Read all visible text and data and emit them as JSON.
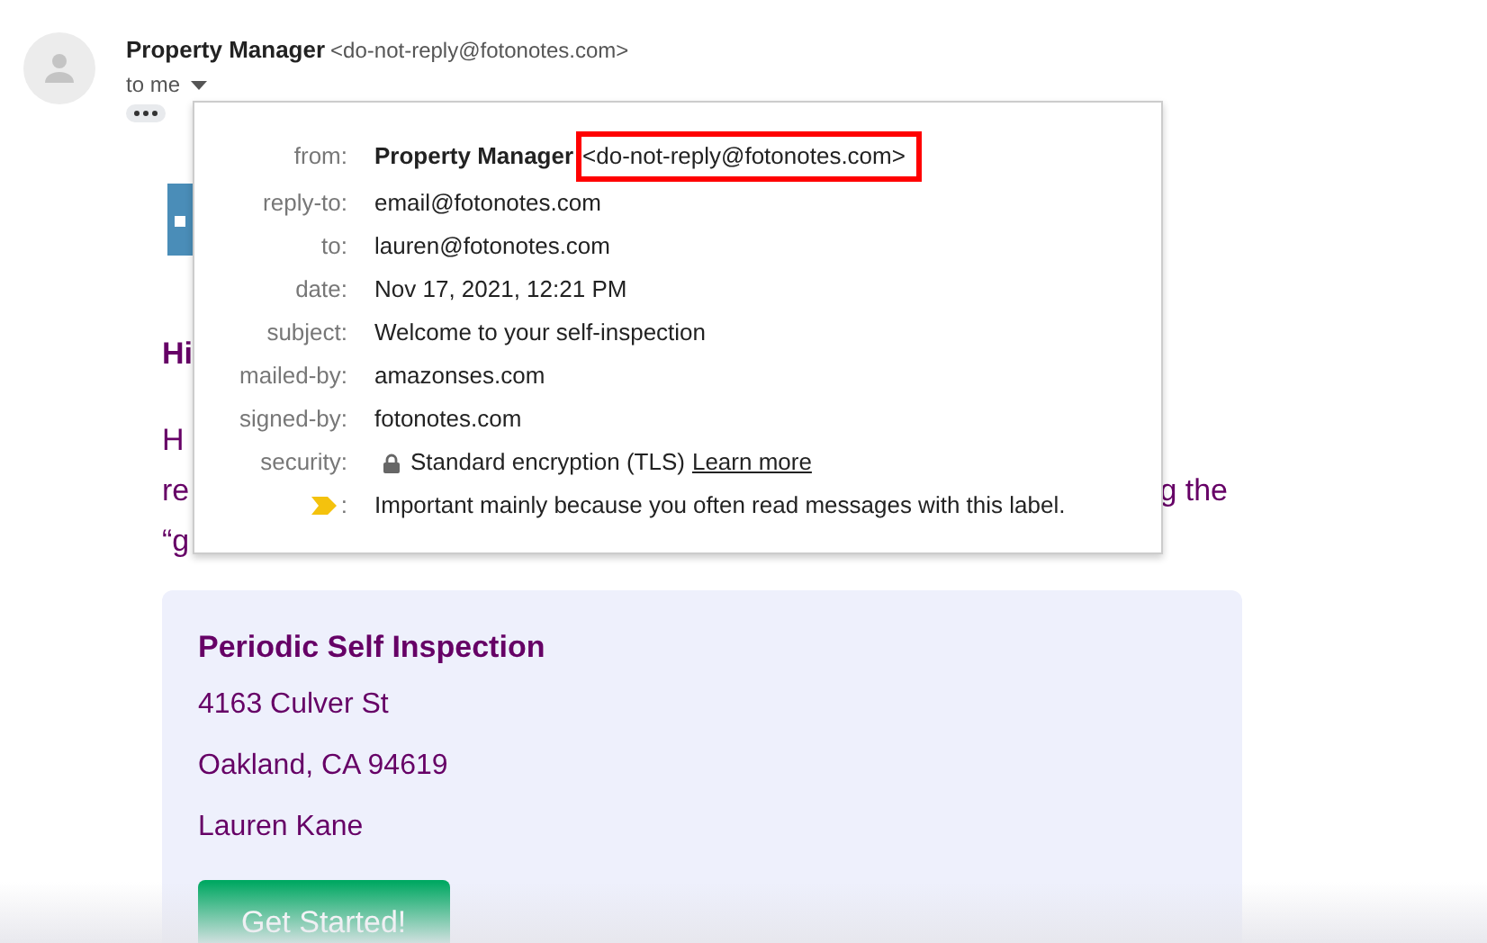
{
  "sender": {
    "name": "Property Manager",
    "email": "<do-not-reply@fotonotes.com>"
  },
  "recipient_line": "to me",
  "details": [
    {
      "kind": "sender",
      "label": "from:",
      "name": "Property Manager",
      "value": "<do-not-reply@fotonotes.com>",
      "highlighted": true
    },
    {
      "kind": "text",
      "label": "reply-to:",
      "value": "email@fotonotes.com"
    },
    {
      "kind": "text",
      "label": "to:",
      "value": "lauren@fotonotes.com"
    },
    {
      "kind": "text",
      "label": "date:",
      "value": "Nov 17, 2021, 12:21 PM"
    },
    {
      "kind": "text",
      "label": "subject:",
      "value": "Welcome to your self-inspection"
    },
    {
      "kind": "text",
      "label": "mailed-by:",
      "value": "amazonses.com"
    },
    {
      "kind": "text",
      "label": "signed-by:",
      "value": "fotonotes.com"
    },
    {
      "kind": "security",
      "label": "security:",
      "value": "Standard encryption (TLS)",
      "link": "Learn more"
    },
    {
      "kind": "importance",
      "label": ":",
      "value": "Important mainly because you often read messages with this label."
    }
  ],
  "body": {
    "greeting": "Hi",
    "lines": [
      {
        "left": "H"
      },
      {
        "left": "re",
        "right": "g the"
      },
      {
        "left": "“g"
      }
    ]
  },
  "card": {
    "title": "Periodic Self Inspection",
    "lines": [
      "4163 Culver St",
      "Oakland, CA 94619",
      "Lauren Kane"
    ],
    "button": "Get Started!"
  }
}
